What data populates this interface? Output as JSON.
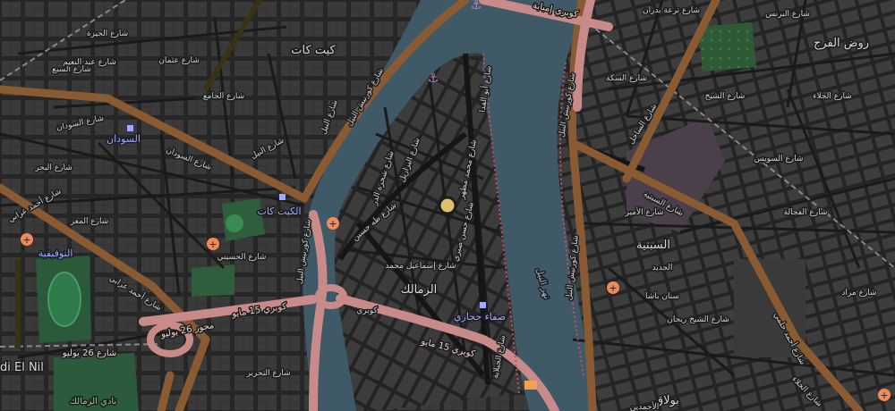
{
  "map": {
    "colors": {
      "background": "#2b2b2b",
      "block": "#3a3a3a",
      "water": "#3f5a66",
      "primary_road": "#8a5a32",
      "trunk_road": "#c98a8a",
      "street": "#1c1c1c",
      "park": "#2f5e3c",
      "hospital_icon": "#f08a5a",
      "sports": "#2f7a4a"
    },
    "labels": {
      "kit_kat_top": "كيت كات",
      "kit_kat_square": "الكيت كات",
      "sudan_area": "السودان",
      "tawfiqia": "التوفيقية",
      "zamalek": "الزمالك",
      "sabtia": "السبتية",
      "rod_el_farag": "روض الفرج",
      "safaa_hegazy": "صفاء حجازي",
      "nile_river": "نهر النيل",
      "sudan_street": "شارع السودان",
      "sudan_street_2": "شارع السودان",
      "corniche_west": "شارع كورنيش النيل",
      "corniche_east": "شارع كورنيش النيل",
      "corniche_east_2": "شارع كورنيش النيل",
      "corniche_west_2": "شارع كورنيش النيل",
      "may15_bridge": "كوبري 15 مايو",
      "may15_bridge_2": "كوبري 15 مايو",
      "july26_street": "شارع 26 يوليو",
      "july26_axis": "محور 26 يوليو",
      "ahmed_orabi": "شارع أحمد عرابي",
      "ahmed_orabi_2": "شارع أحمد عرابي",
      "sabtia_street": "شارع السبتية",
      "ahmed_helmy": "شارع أحمد حلمي",
      "bulaq": "بولاق",
      "imbaba_bridge": "كوبري إمبابة",
      "al_sahel": "شارع الساحل",
      "shoubra": "شارع ترعة بدران",
      "hassan_sabry": "شارع حسن صبري",
      "brazil": "شارع البرازيل",
      "ismail_mohamed": "شارع إسماعيل محمد",
      "mohamed_mazhar": "شارع محمد مظهر",
      "abu_el_feda": "شارع أبو الفدا",
      "taha_hussein": "شارع طه حسين",
      "al_gabalaya": "شارع الجبلاية",
      "shagaret_el_dorr": "شارع شجرة الدر",
      "el_nil_sq": "شارع النيل",
      "corniche_bridge": "كوبري",
      "nadi_zamalek": "نادي الزمالك",
      "al_ahmedein": "الأحمدين",
      "sanan_basha": "سنان باشا",
      "al_gedid": "الجديد",
      "left_edge": "di El Nil",
      "al_suez": "شارع السويس",
      "al_fagala": "شارع الفجالة",
      "galaa": "شارع الجلاء",
      "street_a": "شارع الجيزة",
      "street_b": "شارع عثمان",
      "street_c": "شارع النيل",
      "street_d": "شارع الجامع",
      "street_e": "شارع البحر",
      "street_f": "شارع المعز",
      "street_g": "شارع الحسيني",
      "street_h": "شارع التحرير",
      "street_i": "شارع الجلاء",
      "street_j": "شارع الشيخ",
      "street_k": "شارع السكة",
      "street_l": "شارع السبع",
      "street_m": "شارع البرنس",
      "street_n": "شارع عبد النعيم",
      "street_o": "شارع الشيخ ريحان",
      "street_p": "شارع الأمير",
      "street_q": "شارع مراد"
    },
    "icons": [
      "hospital-icon",
      "hospital-icon",
      "hospital-icon",
      "hospital-icon",
      "hospital-icon",
      "anchor-icon",
      "anchor-icon",
      "museum-icon",
      "monument-marker"
    ]
  }
}
